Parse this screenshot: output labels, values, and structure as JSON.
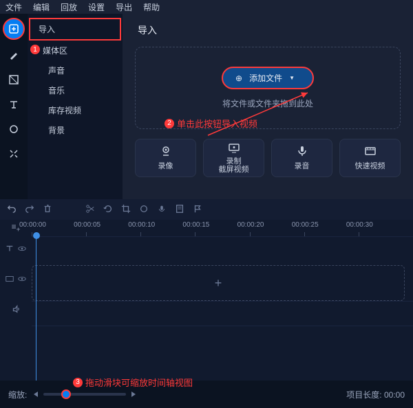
{
  "menu": [
    "文件",
    "编辑",
    "回放",
    "设置",
    "导出",
    "帮助"
  ],
  "sidebar": {
    "items": [
      {
        "label": "导入",
        "level": 0
      },
      {
        "label": "媒体区",
        "level": 1
      },
      {
        "label": "声音",
        "level": 2
      },
      {
        "label": "音乐",
        "level": 2
      },
      {
        "label": "库存视频",
        "level": 2
      },
      {
        "label": "背景",
        "level": 2
      }
    ]
  },
  "content": {
    "title": "导入",
    "add_file": "添加文件",
    "drop_hint": "将文件或文件夹拖到此处"
  },
  "annotations": {
    "step1_num": "1",
    "step2_num": "2",
    "step2_text": "单击此按钮导入视频",
    "step3_num": "3",
    "step3_text": "拖动滑块可缩放时间轴视图"
  },
  "capture": [
    {
      "label": "录像",
      "icon": "webcam"
    },
    {
      "label": "录制",
      "sub": "截屏视频",
      "icon": "screen"
    },
    {
      "label": "录音",
      "icon": "mic"
    },
    {
      "label": "快速视频",
      "icon": "quick"
    }
  ],
  "ruler": [
    "00:00:00",
    "00:00:05",
    "00:00:10",
    "00:00:15",
    "00:00:20",
    "00:00:25",
    "00:00:30"
  ],
  "zoom": {
    "label": "缩放:"
  },
  "project_length": {
    "label": "项目长度:",
    "value": "00:00"
  }
}
